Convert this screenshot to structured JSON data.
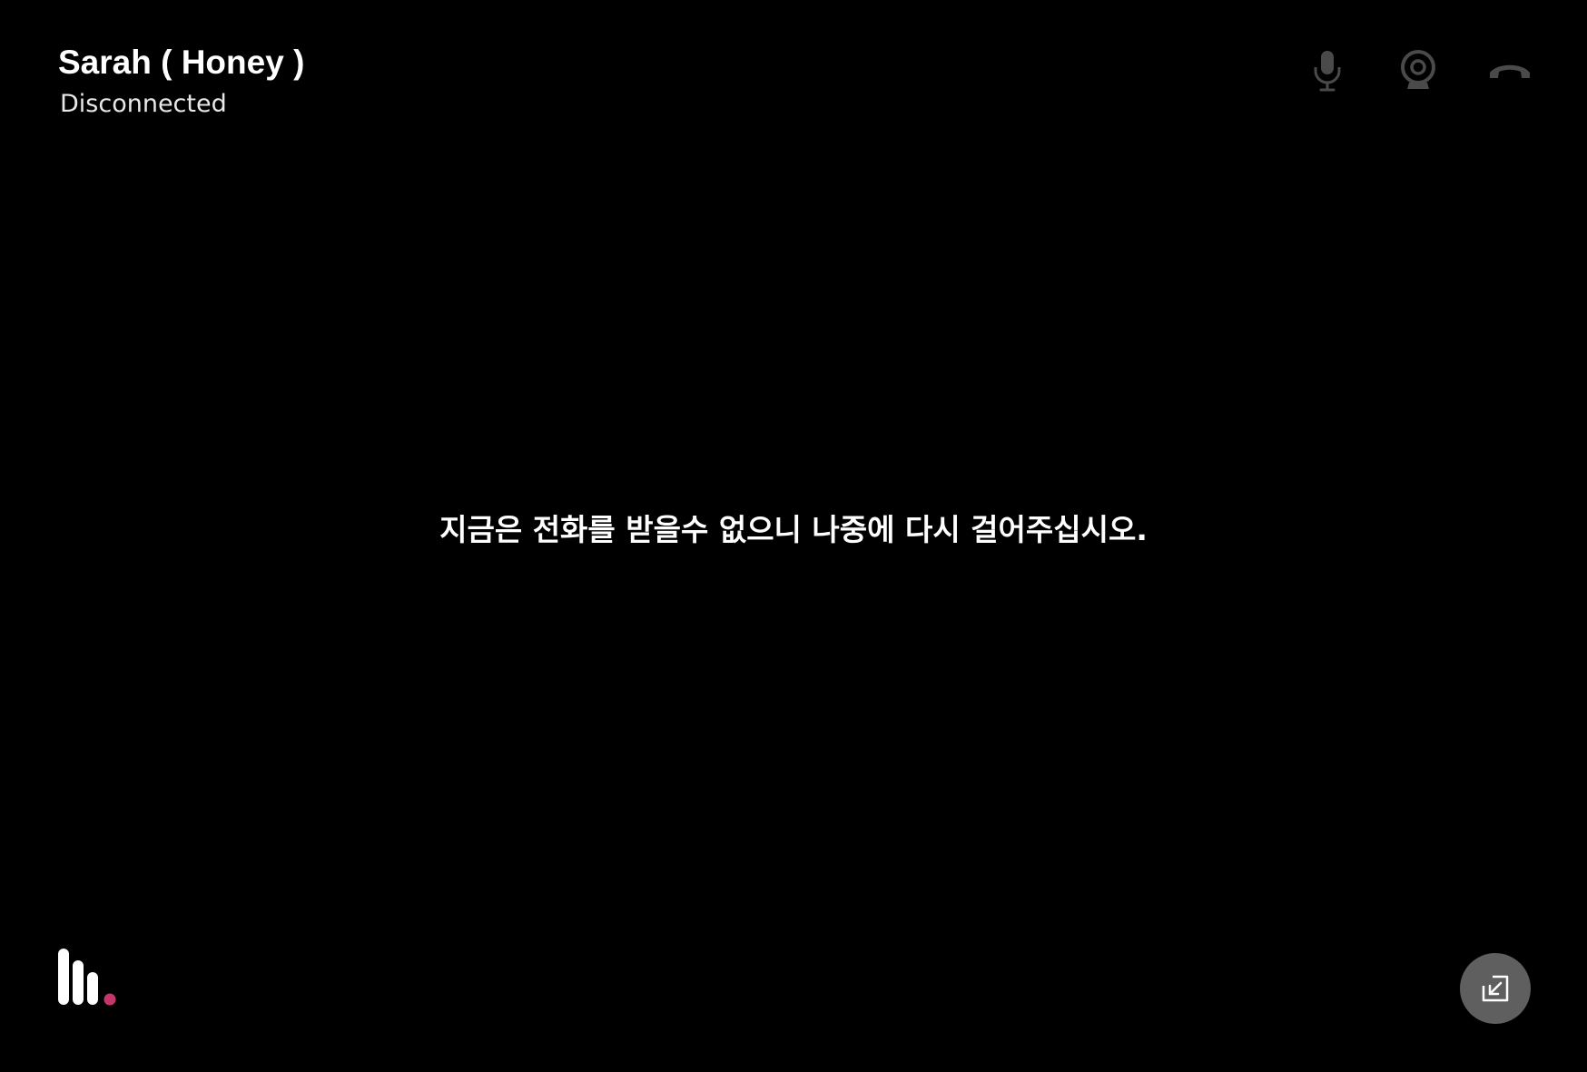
{
  "call": {
    "contact_name": "Sarah ( Honey )",
    "status": "Disconnected",
    "message": "지금은 전화를 받을수 없으니 나중에 다시 걸어주십시오."
  },
  "controls": [
    {
      "name": "mic",
      "icon": "microphone-icon",
      "state": "disabled"
    },
    {
      "name": "camera",
      "icon": "webcam-icon",
      "state": "disabled"
    },
    {
      "name": "end-call",
      "icon": "hang-up-phone-icon",
      "state": "disabled"
    }
  ],
  "bottom": {
    "logo_icon": "app-logo-bars-icon",
    "minimize_icon": "arrow-down-left-minimize-icon"
  },
  "colors": {
    "background": "#000000",
    "text_primary": "#ffffff",
    "icon_disabled": "#4a4a4a",
    "accent_dot": "#c2366b",
    "minimize_button_bg": "#5f5f5f"
  }
}
